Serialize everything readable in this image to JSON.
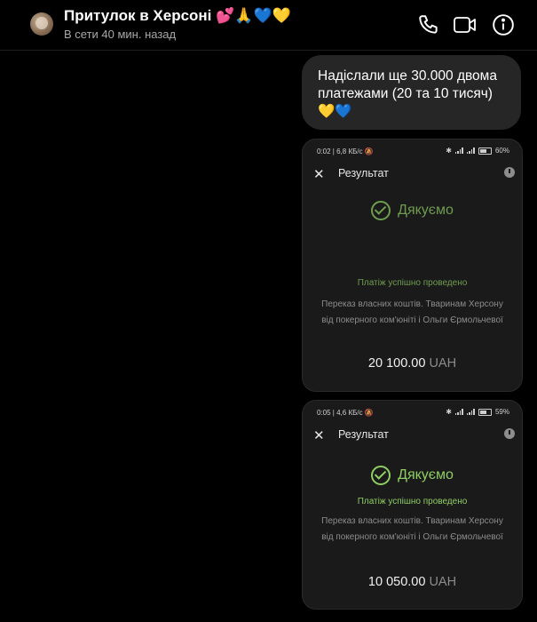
{
  "header": {
    "title": "Притулок в Херсоні 💕🙏💙💛",
    "status": "В сети 40 мин. назад"
  },
  "message": {
    "text": "Надіслали ще 30.000 двома платежами (20 та 10 тисяч) 💛💙"
  },
  "screenshots": [
    {
      "statusbar_left": "0:02 | 6,8 КБ/с",
      "battery": "60%",
      "result_title": "Результат",
      "thanks": "Дякуємо",
      "ok_text": "Платіж успішно проведено",
      "desc_line1": "Переказ власних коштів. Тваринам Херсону",
      "desc_line2": "від покерного ком'юніті і Ольги Єрмольчевої",
      "amount": "20 100.00",
      "currency": "UAH"
    },
    {
      "statusbar_left": "0:05 | 4,6 КБ/с",
      "battery": "59%",
      "result_title": "Результат",
      "thanks": "Дякуємо",
      "ok_text": "Платіж успішно проведено",
      "desc_line1": "Переказ власних коштів. Тваринам Херсону",
      "desc_line2": "від покерного ком'юніті і Ольги Єрмольчевої",
      "amount": "10 050.00",
      "currency": "UAH"
    }
  ],
  "colors": {
    "background": "#000000",
    "bubble": "#262626",
    "screenshot_bg": "#1a1a1a",
    "green_dim": "#6f9c4f",
    "green_bright": "#8fce63"
  }
}
